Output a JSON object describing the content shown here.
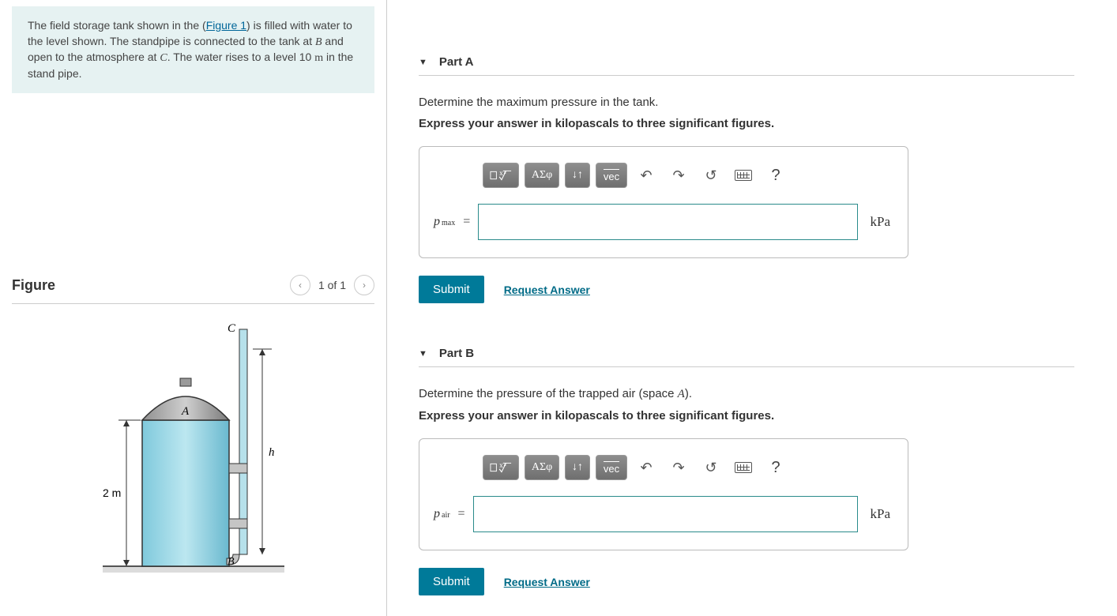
{
  "problem": {
    "text_prefix": "The field storage tank shown in the (",
    "figure_link": "Figure 1",
    "text_mid1": ") is filled with water to the level shown. The standpipe is connected to the tank at ",
    "varB": "B",
    "text_mid2": " and open to the atmosphere at ",
    "varC": "C",
    "text_mid3": ". The water rises to a level 10 ",
    "unit_m": "m",
    "text_suffix": " in the stand pipe."
  },
  "figure": {
    "title": "Figure",
    "counter": "1 of 1",
    "labels": {
      "C": "C",
      "A": "A",
      "B": "B",
      "h": "h",
      "dim": "2 m"
    }
  },
  "toolbar": {
    "greek": "ΑΣφ",
    "arrows": "↓↑",
    "vec": "vec",
    "undo": "↶",
    "redo": "↷",
    "reset": "↺",
    "help": "?"
  },
  "partA": {
    "title": "Part A",
    "instruction": "Determine the maximum pressure in the tank.",
    "express": "Express your answer in kilopascals to three significant figures.",
    "var": "p",
    "sub": "max",
    "eq": "=",
    "unit": "kPa",
    "submit": "Submit",
    "request": "Request Answer"
  },
  "partB": {
    "title": "Part B",
    "instruction_prefix": "Determine the pressure of the trapped air (space ",
    "spaceA": "A",
    "instruction_suffix": ").",
    "express": "Express your answer in kilopascals to three significant figures.",
    "var": "p",
    "sub": "air",
    "eq": "=",
    "unit": "kPa",
    "submit": "Submit",
    "request": "Request Answer"
  }
}
